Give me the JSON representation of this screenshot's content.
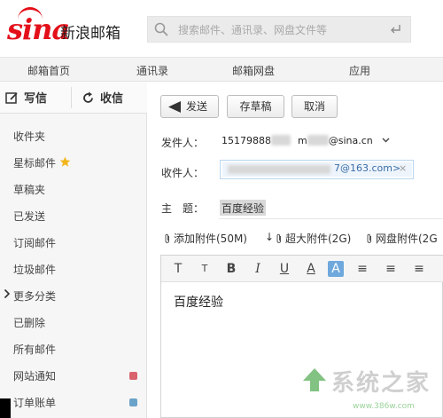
{
  "header": {
    "logo_brand": "sina",
    "logo_product": "新浪邮箱",
    "search_placeholder": "搜索邮件、通讯录、网盘文件等"
  },
  "nav": {
    "items": [
      "邮箱首页",
      "通讯录",
      "邮箱网盘",
      "应用"
    ]
  },
  "sidebar": {
    "write_label": "写信",
    "receive_label": "收信",
    "folders": [
      {
        "label": "收件夹"
      },
      {
        "label": "星标邮件",
        "icon": "star-icon"
      },
      {
        "label": "草稿夹"
      },
      {
        "label": "已发送"
      },
      {
        "label": "订阅邮件"
      },
      {
        "label": "垃圾邮件"
      },
      {
        "label": "更多分类",
        "icon": "chevron-right-icon"
      },
      {
        "label": "已删除"
      },
      {
        "label": "所有邮件"
      },
      {
        "label": "网站通知",
        "color": "#d9636c"
      },
      {
        "label": "订单账单",
        "color": "#6aa3c9"
      }
    ]
  },
  "compose": {
    "send_label": "发送",
    "draft_label": "存草稿",
    "cancel_label": "取消",
    "from_label": "发件人：",
    "from_value_prefix": "15179888",
    "from_value_mid": "m",
    "from_value_suffix": "@sina.cn",
    "to_label": "收件人：",
    "to_value": "7@163.com>",
    "to_remove": "×",
    "subject_label": "主　题：",
    "subject_value": "百度经验",
    "attachments": [
      {
        "label": "添加附件(50M)"
      },
      {
        "label": "超大附件(2G)"
      },
      {
        "label": "网盘附件(2G"
      }
    ],
    "attach_arrow": "↓",
    "toolbar": [
      "T",
      "T",
      "B",
      "I",
      "U",
      "A",
      "A",
      "≡",
      "≡",
      "≡"
    ],
    "body_text": "百度经验"
  },
  "watermark": {
    "text": "系统之家",
    "url": "www.386w.com"
  }
}
